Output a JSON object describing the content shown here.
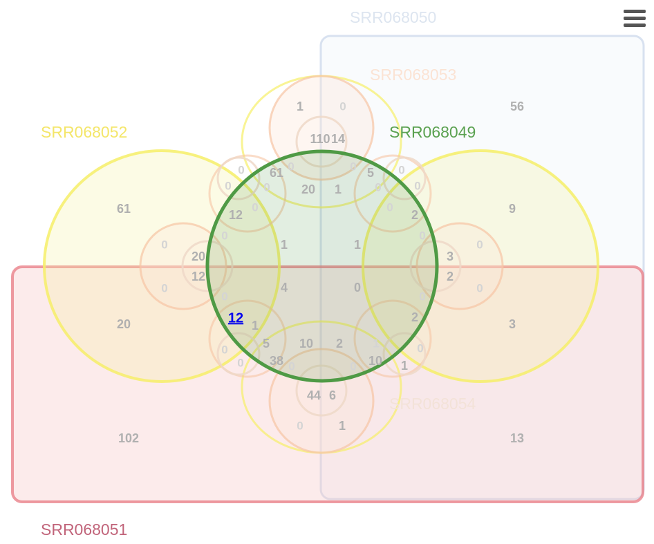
{
  "menu": {
    "icon": "hamburger-menu-icon"
  },
  "colors": {
    "SRR068049": "#4f9a45",
    "SRR068050": "#c9d6ea",
    "SRR068051": "#e87a83",
    "SRR068052": "#f6ef68",
    "SRR068053": "#f7c4a4",
    "SRR068054": "#efd8c8"
  },
  "set_labels": {
    "SRR068049": "SRR068049",
    "SRR068050": "SRR068050",
    "SRR068051": "SRR068051",
    "SRR068052": "SRR068052",
    "SRR068053": "SRR068053",
    "SRR068054": "SRR068054"
  },
  "highlighted_set": "SRR068049",
  "highlighted_count": "12",
  "counts": [
    "1",
    "0",
    "110",
    "14",
    "56",
    "61",
    "0",
    "61",
    "0",
    "0",
    "20",
    "1",
    "5",
    "0",
    "0",
    "0",
    "0",
    "2",
    "0",
    "9",
    "12",
    "0",
    "20",
    "12",
    "0",
    "1",
    "1",
    "3",
    "2",
    "0",
    "0",
    "0",
    "4",
    "0",
    "0",
    "0",
    "20",
    "1",
    "2",
    "3",
    "0",
    "5",
    "10",
    "2",
    "0",
    "0",
    "38",
    "0",
    "0",
    "10",
    "1",
    "44",
    "6",
    "102",
    "13",
    "0",
    "1"
  ]
}
